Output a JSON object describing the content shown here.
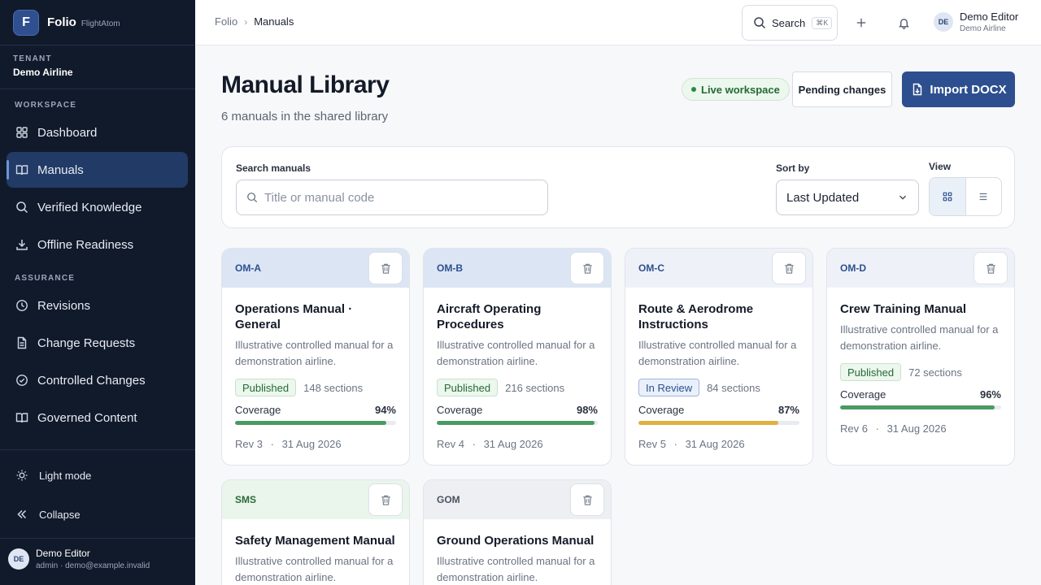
{
  "brand": {
    "logo_letter": "F",
    "name": "Folio",
    "sub": "FlightAtom"
  },
  "tenant": {
    "label": "TENANT",
    "name": "Demo Airline"
  },
  "sidebar": {
    "workspace_label": "WORKSPACE",
    "assurance_label": "ASSURANCE",
    "items": [
      {
        "label": "Dashboard",
        "icon": "dashboard-icon"
      },
      {
        "label": "Manuals",
        "icon": "book-icon",
        "active": true
      },
      {
        "label": "Verified Knowledge",
        "icon": "search-icon"
      },
      {
        "label": "Offline Readiness",
        "icon": "download-icon"
      },
      {
        "label": "Revisions",
        "icon": "clock-icon"
      },
      {
        "label": "Change Requests",
        "icon": "document-icon"
      },
      {
        "label": "Controlled Changes",
        "icon": "check-circle-icon"
      },
      {
        "label": "Governed Content",
        "icon": "book-icon"
      }
    ],
    "light_mode": "Light mode",
    "collapse": "Collapse",
    "user": {
      "initials": "DE",
      "name": "Demo Editor",
      "meta": "admin · demo@example.invalid"
    }
  },
  "topbar": {
    "breadcrumb": {
      "root": "Folio",
      "current": "Manuals"
    },
    "search_label": "Search",
    "search_shortcut": "⌘K",
    "user": {
      "initials": "DE",
      "name": "Demo Editor",
      "org": "Demo Airline"
    }
  },
  "header": {
    "title": "Manual Library",
    "subtitle": "6 manuals in the shared library",
    "live_label": "Live workspace",
    "pending_label": "Pending changes",
    "import_label": "Import DOCX"
  },
  "filters": {
    "search_label": "Search manuals",
    "search_placeholder": "Title or manual code",
    "sort_label": "Sort by",
    "sort_value": "Last Updated",
    "view_label": "View",
    "view_mode": "grid"
  },
  "manuals": [
    {
      "code": "OM-A",
      "title": "Operations Manual · General",
      "desc": "Illustrative controlled manual for a demonstration airline.",
      "status": "Published",
      "sections": "148 sections",
      "coverage_label": "Coverage",
      "coverage": "94%",
      "coverage_value": 94,
      "rev": "Rev 3",
      "date": "31 Aug 2026"
    },
    {
      "code": "OM-B",
      "title": "Aircraft Operating Procedures",
      "desc": "Illustrative controlled manual for a demonstration airline.",
      "status": "Published",
      "sections": "216 sections",
      "coverage_label": "Coverage",
      "coverage": "98%",
      "coverage_value": 98,
      "rev": "Rev 4",
      "date": "31 Aug 2026"
    },
    {
      "code": "OM-C",
      "title": "Route & Aerodrome Instructions",
      "desc": "Illustrative controlled manual for a demonstration airline.",
      "status": "In Review",
      "sections": "84 sections",
      "coverage_label": "Coverage",
      "coverage": "87%",
      "coverage_value": 87,
      "rev": "Rev 5",
      "date": "31 Aug 2026"
    },
    {
      "code": "OM-D",
      "title": "Crew Training Manual",
      "desc": "Illustrative controlled manual for a demonstration airline.",
      "status": "Published",
      "sections": "72 sections",
      "coverage_label": "Coverage",
      "coverage": "96%",
      "coverage_value": 96,
      "rev": "Rev 6",
      "date": "31 Aug 2026"
    },
    {
      "code": "SMS",
      "title": "Safety Management Manual",
      "desc": "Illustrative controlled manual for a demonstration airline."
    },
    {
      "code": "GOM",
      "title": "Ground Operations Manual",
      "desc": "Illustrative controlled manual for a demonstration airline."
    }
  ],
  "separator": "·"
}
